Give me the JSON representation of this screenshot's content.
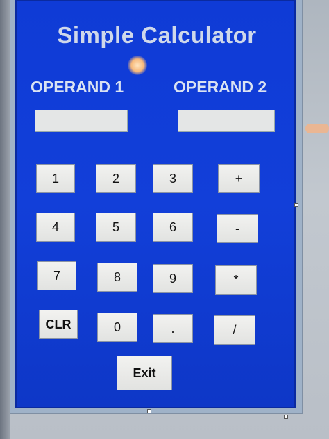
{
  "app": {
    "title": "Simple Calculator"
  },
  "operands": {
    "label_1": "OPERAND 1",
    "label_2": "OPERAND 2",
    "value_1": "",
    "value_2": ""
  },
  "keypad": {
    "rows": [
      [
        "1",
        "2",
        "3",
        "+"
      ],
      [
        "4",
        "5",
        "6",
        "-"
      ],
      [
        "7",
        "8",
        "9",
        "*"
      ],
      [
        "CLR",
        "0",
        ".",
        "/"
      ]
    ]
  },
  "exit_label": "Exit"
}
